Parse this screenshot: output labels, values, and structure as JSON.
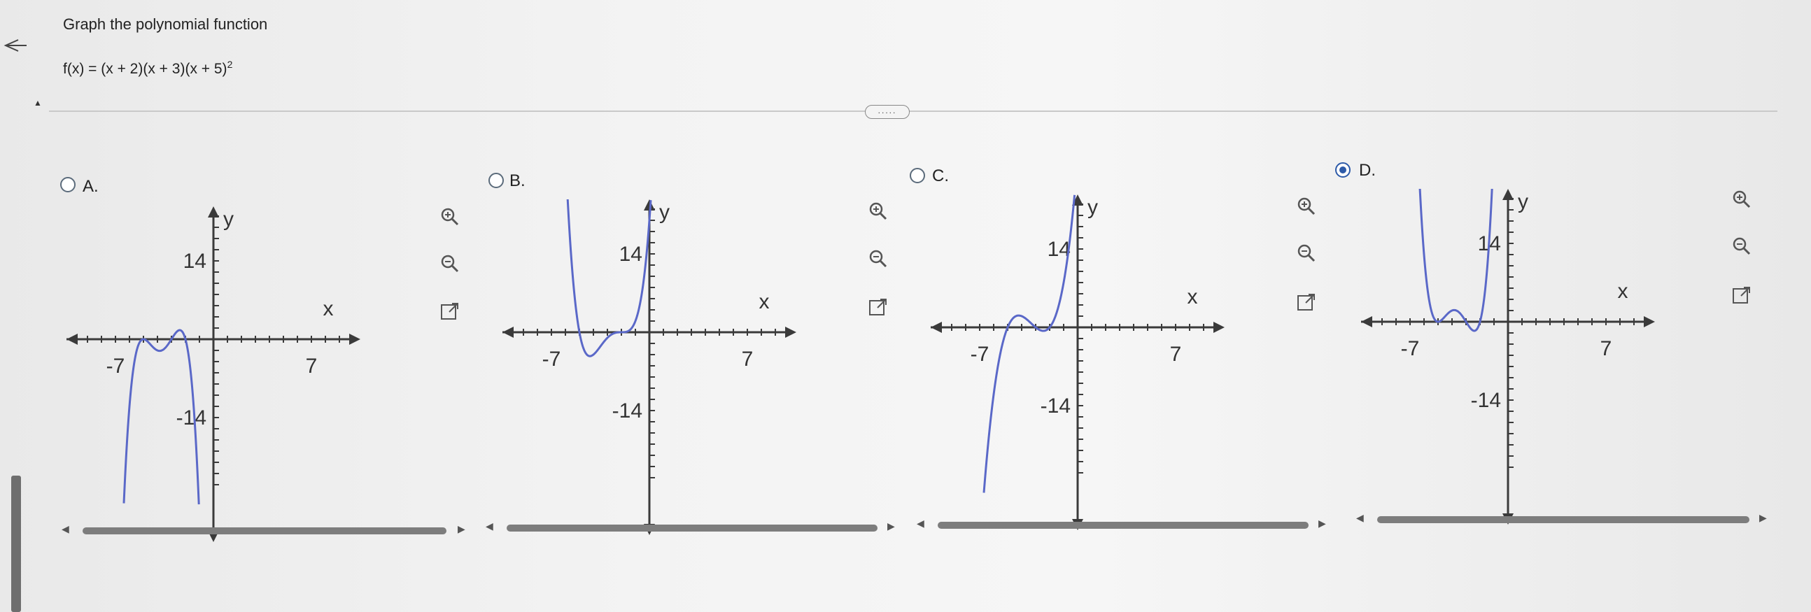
{
  "header": {
    "instruction": "Graph the polynomial function",
    "formula_base": "f(x) = (x + 2)(x + 3)(x + 5)",
    "formula_exp": "2",
    "more_label": "....."
  },
  "options": [
    {
      "letter": "A.",
      "selected": false
    },
    {
      "letter": "B.",
      "selected": false
    },
    {
      "letter": "C.",
      "selected": false
    },
    {
      "letter": "D.",
      "selected": true
    }
  ],
  "axes": {
    "x_label": "x",
    "y_label": "y",
    "x_neg_tick": "-7",
    "x_pos_tick": "7",
    "y_pos_tick": "14",
    "y_neg_tick": "-14"
  },
  "icons": {
    "zoom_in": "zoom-in-icon",
    "zoom_out": "zoom-out-icon",
    "open_new": "open-in-new-window-icon"
  },
  "colors": {
    "curve": "#5a68c8",
    "selected": "#2d5aa8",
    "axis": "#3a3a3a"
  }
}
